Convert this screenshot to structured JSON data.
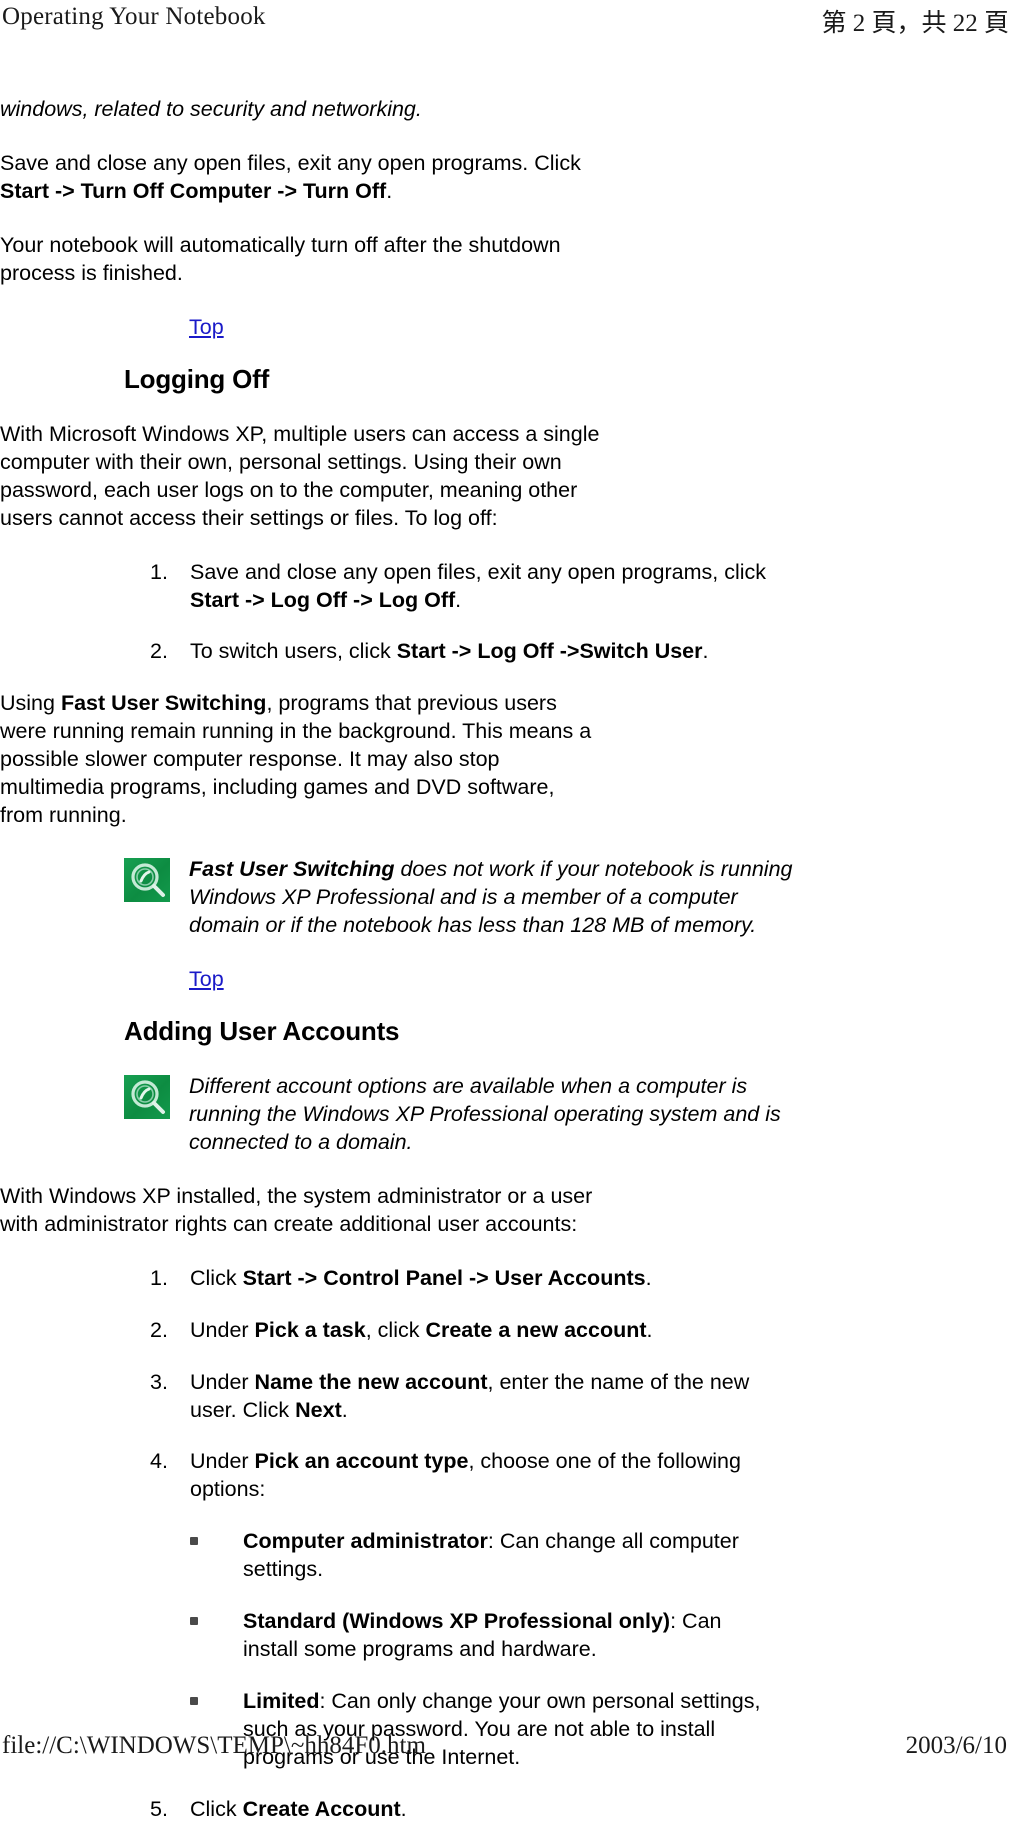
{
  "header": {
    "left_title": "Operating Your Notebook",
    "right_pagination": "第 2 頁，共 22 頁"
  },
  "footer": {
    "file_path": "file://C:\\WINDOWS\\TEMP\\~hh84F0.htm",
    "date": "2003/6/10"
  },
  "colors": {
    "link": "#1a1ac8",
    "note_icon_green": "#1a9c4e",
    "text": "#000000"
  },
  "content": {
    "intro_italic": "windows, related to security and networking.",
    "shutdown_para": {
      "pre": "Save and close any open files, exit any open programs. Click ",
      "bold": "Start -> Turn Off Computer -> Turn Off",
      "post": "."
    },
    "auto_off_para": "Your notebook will automatically turn off after the shutdown process is finished.",
    "top_link_1": "Top",
    "top_link_2": "Top",
    "sections": [
      {
        "heading": "Logging Off",
        "intro": "With Microsoft Windows XP, multiple users can access a single computer with their own, personal settings. Using their own password, each user logs on to the computer, meaning other users cannot access their settings or files. To log off:",
        "steps": [
          {
            "number": "1.",
            "pre": "Save and close any open files, exit any open programs, click ",
            "bold": "Start -> Log Off -> Log Off",
            "post": "."
          },
          {
            "number": "2.",
            "pre": "To switch users, click ",
            "bold": "Start -> Log Off ->Switch User",
            "post": "."
          }
        ],
        "after_steps_para": {
          "pre": "Using ",
          "bold": "Fast User Switching",
          "post": ", programs that previous users were running remain running in the background. This means a possible slower computer response. It may also stop multimedia programs, including games and DVD software, from running."
        },
        "note": {
          "icon": "note-green-icon",
          "bold": "Fast User Switching",
          "rest": " does not work if your notebook is running Windows XP Professional and is a member of a computer domain or if the notebook has less than 128 MB of memory."
        }
      },
      {
        "heading": "Adding User Accounts",
        "note": {
          "icon": "note-green-icon",
          "bold": "",
          "rest": "Different account options are available when a computer is running the Windows XP Professional operating system and is connected to a domain."
        },
        "intro": "With Windows XP installed, the system administrator or a user with administrator rights can create additional user accounts:",
        "steps": [
          {
            "number": "1.",
            "pre": "Click ",
            "bold": "Start -> Control Panel -> User Accounts",
            "post": "."
          },
          {
            "number": "2.",
            "pre": "Under ",
            "bold": "Pick a task",
            "mid": ", click ",
            "bold2": "Create a new account",
            "post": "."
          },
          {
            "number": "3.",
            "pre": "Under ",
            "bold": "Name the new account",
            "mid": ", enter the name of the new user. Click ",
            "bold2": "Next",
            "post": "."
          },
          {
            "number": "4.",
            "pre": "Under ",
            "bold": "Pick an account type",
            "post": ", choose one of the following options:"
          }
        ],
        "bullets": [
          {
            "bold": "Computer administrator",
            "rest": ": Can change all computer settings."
          },
          {
            "bold": "Standard (Windows XP Professional only)",
            "rest": ": Can install some programs and hardware."
          },
          {
            "bold": "Limited",
            "rest": ": Can only change your own personal settings, such as your password. You are not able to install programs or use the Internet."
          }
        ],
        "final_step": {
          "number": "5.",
          "pre": "Click ",
          "bold": "Create Account",
          "post": "."
        }
      }
    ]
  }
}
